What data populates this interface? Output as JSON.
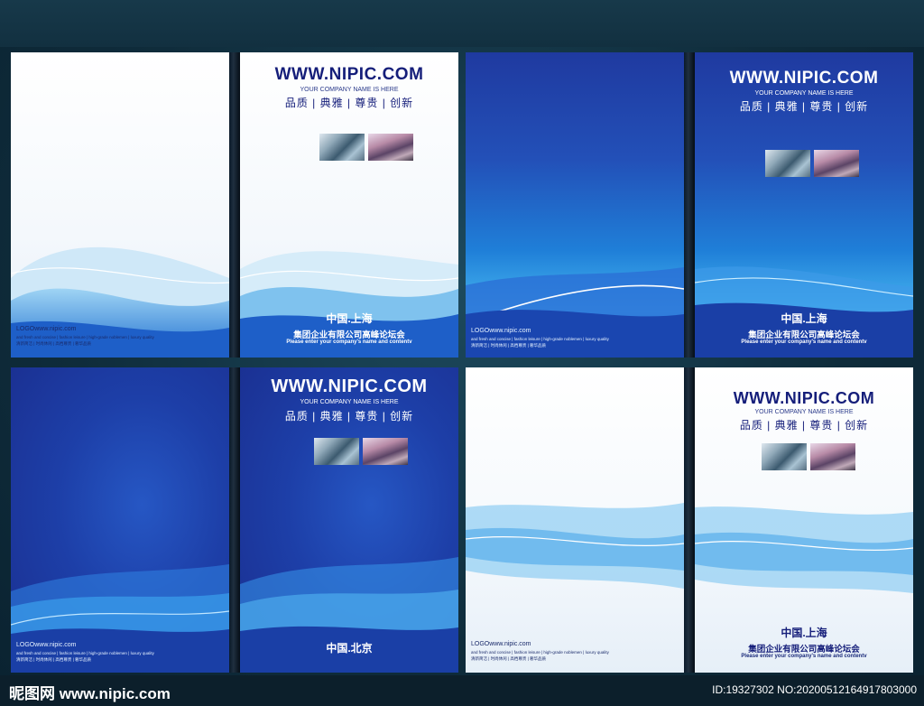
{
  "url": "WWW.NIPIC.COM",
  "company_tag": "YOUR COMPANY NAME IS HERE",
  "motto": "品质 | 典雅 | 尊贵 | 创新",
  "city_shanghai": "中国.上海",
  "city_beijing": "中国.北京",
  "company": "集团企业有限公司高峰论坛会",
  "enter_text": "Please enter your company's name and contentv",
  "logo_text": "LOGOwww.nipic.com",
  "fine_line1": "and fresh and concise | fashion leisure | high-grade noblemen | luxury quality",
  "fine_line2": "清新简洁 | 时尚休闲 | 高档尊贵 | 奢华品质",
  "watermark": {
    "site": "昵图网 www.nipic.com",
    "id": "ID:19327302 NO:20200512164917803000"
  },
  "colors": {
    "navy_text": "#151e7a",
    "accent_blue": "#1f7fd8",
    "dark_bg": "#1a2e8f"
  }
}
